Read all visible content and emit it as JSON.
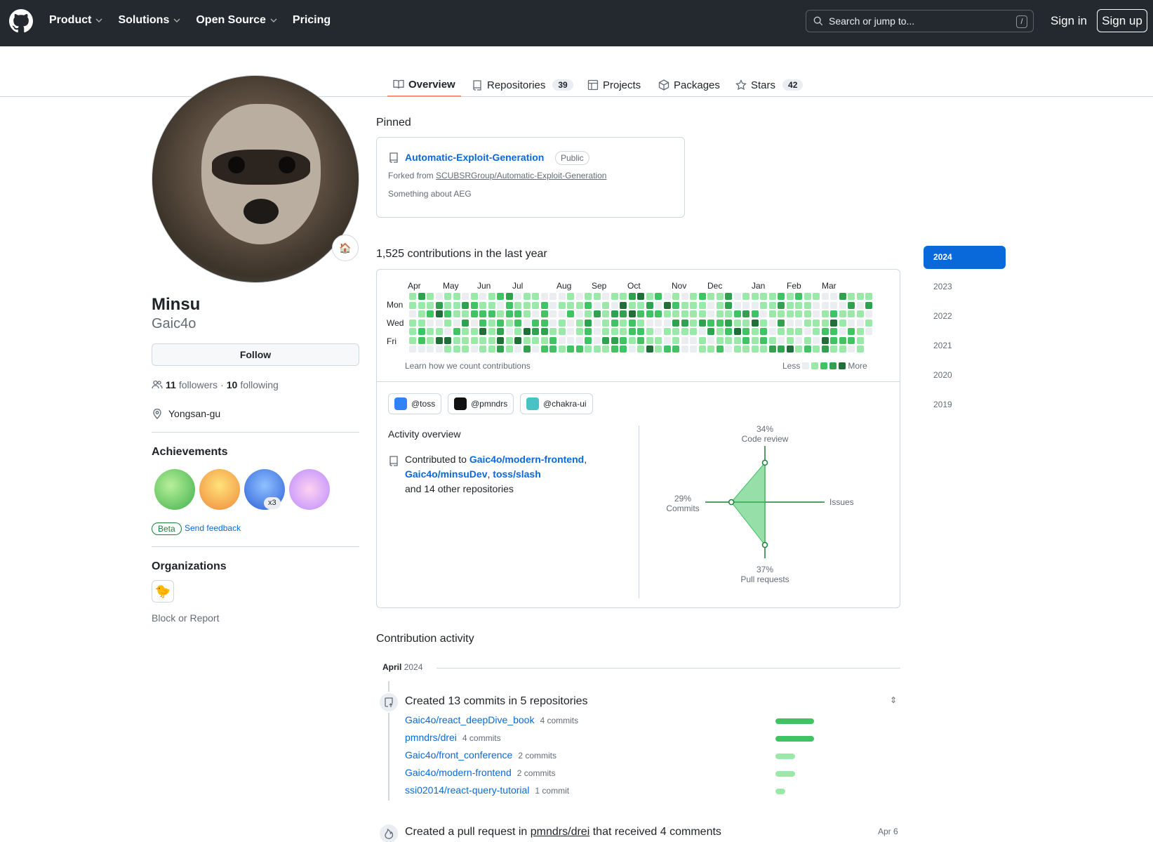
{
  "header": {
    "nav": [
      "Product",
      "Solutions",
      "Open Source",
      "Pricing"
    ],
    "search_placeholder": "Search or jump to...",
    "search_key": "/",
    "sign_in": "Sign in",
    "sign_up": "Sign up"
  },
  "tabs": [
    {
      "label": "Overview",
      "count": null,
      "icon": "book-icon"
    },
    {
      "label": "Repositories",
      "count": "39",
      "icon": "repo-icon"
    },
    {
      "label": "Projects",
      "count": null,
      "icon": "table-icon"
    },
    {
      "label": "Packages",
      "count": null,
      "icon": "package-icon"
    },
    {
      "label": "Stars",
      "count": "42",
      "icon": "star-icon"
    }
  ],
  "profile": {
    "name": "Minsu",
    "login": "Gaic4o",
    "follow": "Follow",
    "followers": "11",
    "followers_label": "followers",
    "dot": "·",
    "following": "10",
    "following_label": "following",
    "location": "Yongsan-gu",
    "status_emoji": "🏠"
  },
  "achievements": {
    "title": "Achievements",
    "badge_count": "x3",
    "beta": "Beta",
    "feedback": "Send feedback"
  },
  "organizations": {
    "title": "Organizations",
    "org_emoji": "🐤",
    "block": "Block or Report"
  },
  "pinned": {
    "title": "Pinned",
    "repo": "Automatic-Exploit-Generation",
    "visibility": "Public",
    "forked_prefix": "Forked from ",
    "forked_from": "SCUBSRGroup/Automatic-Exploit-Generation",
    "description": "Something about AEG"
  },
  "contributions": {
    "title": "1,525 contributions in the last year",
    "months": [
      "Apr",
      "May",
      "Jun",
      "Jul",
      "Aug",
      "Sep",
      "Oct",
      "Nov",
      "Dec",
      "Jan",
      "Feb",
      "Mar"
    ],
    "days": [
      "Mon",
      "Wed",
      "Fri"
    ],
    "learn": "Learn how we count contributions",
    "less": "Less",
    "more": "More",
    "colors": [
      "#ebedf0",
      "#9be9a8",
      "#40c463",
      "#30a14e",
      "#216e39"
    ]
  },
  "orgs_filter": [
    {
      "label": "@toss",
      "color": "#3182f6"
    },
    {
      "label": "@pmndrs",
      "color": "#111111"
    },
    {
      "label": "@chakra-ui",
      "color": "#48c2c4"
    }
  ],
  "activity_overview": {
    "title": "Activity overview",
    "contributed_to": "Contributed to",
    "repo1": "Gaic4o/modern-frontend",
    "repo2": "Gaic4o/minsuDev",
    "repo3": "toss/slash",
    "sep1": ",",
    "sep2": ",",
    "others": "and 14 other repositories"
  },
  "chart_data": {
    "type": "radar",
    "axes": [
      {
        "name": "Code review",
        "value": 34,
        "label": "34%"
      },
      {
        "name": "Issues",
        "value": 0,
        "label": ""
      },
      {
        "name": "Pull requests",
        "value": 37,
        "label": "37%"
      },
      {
        "name": "Commits",
        "value": 29,
        "label": "29%"
      }
    ]
  },
  "years": [
    "2024",
    "2023",
    "2022",
    "2021",
    "2020",
    "2019"
  ],
  "activity": {
    "title": "Contribution activity",
    "month": "April",
    "year": "2024",
    "commits_event": "Created 13 commits in 5 repositories",
    "repos": [
      {
        "name": "Gaic4o/react_deepDive_book",
        "count": "4 commits",
        "level": 1.0
      },
      {
        "name": "pmndrs/drei",
        "count": "4 commits",
        "level": 1.0
      },
      {
        "name": "Gaic4o/front_conference",
        "count": "2 commits",
        "level": 0.5
      },
      {
        "name": "Gaic4o/modern-frontend",
        "count": "2 commits",
        "level": 0.5
      },
      {
        "name": "ssi02014/react-query-tutorial",
        "count": "1 commit",
        "level": 0.25
      }
    ],
    "pr_event_prefix": "Created a pull request in",
    "pr_repo": "pmndrs/drei",
    "pr_event_suffix": "that received 4 comments",
    "pr_date": "Apr 6"
  }
}
